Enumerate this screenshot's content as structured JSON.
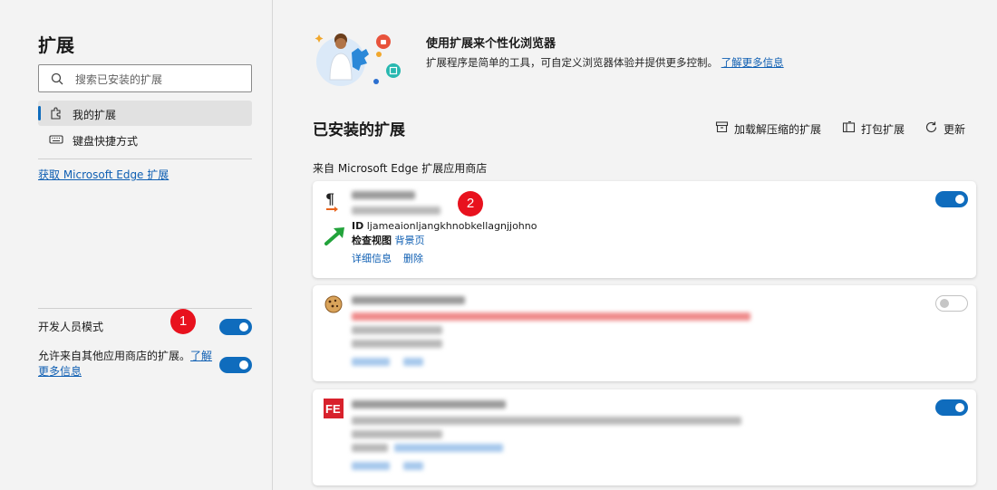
{
  "sidebar": {
    "title": "扩展",
    "search_placeholder": "搜索已安装的扩展",
    "nav": [
      {
        "label": "我的扩展"
      },
      {
        "label": "键盘快捷方式"
      }
    ],
    "get_extensions_link": "获取 Microsoft Edge 扩展",
    "developer_mode_label": "开发人员模式",
    "allow_other_stores_text": "允许来自其他应用商店的扩展。",
    "allow_other_stores_link": "了解更多信息"
  },
  "badges": [
    "1",
    "2"
  ],
  "banner": {
    "title": "使用扩展来个性化浏览器",
    "description": "扩展程序是简单的工具，可自定义浏览器体验并提供更多控制。",
    "learn_more": "了解更多信息"
  },
  "installed": {
    "title": "已安装的扩展",
    "actions": {
      "load_unpacked": "加载解压缩的扩展",
      "pack": "打包扩展",
      "update": "更新"
    },
    "source_label": "来自 Microsoft Edge 扩展应用商店"
  },
  "extensions": [
    {
      "enabled": true,
      "id_label": "ID",
      "id_value": "ljameaionljangkhnobkellagnjjohno",
      "inspect_label": "检查视图",
      "background_link": "背景页",
      "details_link": "详细信息",
      "remove_link": "删除"
    },
    {
      "enabled": false
    },
    {
      "enabled": true
    }
  ],
  "colors": {
    "accent": "#0f6cbd",
    "badge": "#e8121e",
    "background": "#f3f3f3"
  }
}
